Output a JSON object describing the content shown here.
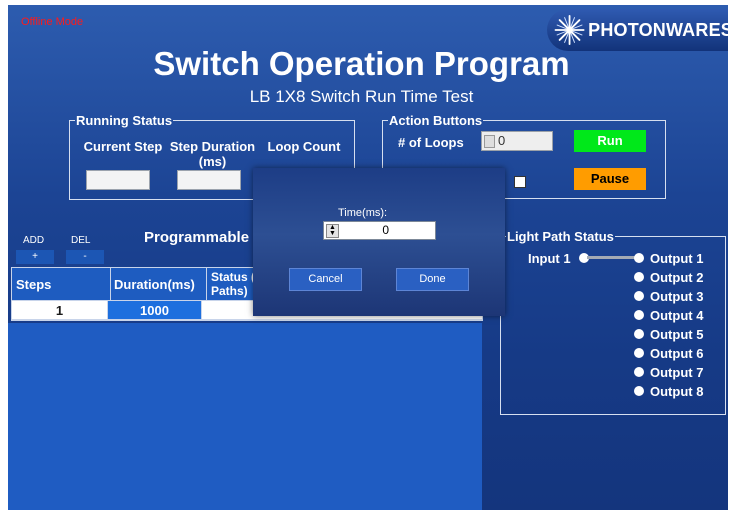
{
  "offline_mode": "Offline Mode",
  "logo": {
    "brand": "PHOTONWARES"
  },
  "title": "Switch Operation Program",
  "subtitle": "LB 1X8 Switch Run Time Test",
  "running_status": {
    "legend": "Running Status",
    "current_step_label": "Current Step",
    "step_duration_label": "Step Duration (ms)",
    "loop_count_label": "Loop Count",
    "current_step_value": "",
    "step_duration_value": ""
  },
  "action_buttons": {
    "legend": "Action Buttons",
    "loops_label": "# of Loops",
    "loops_value": "0",
    "run_label": "Run",
    "pause_label": "Pause"
  },
  "program": {
    "add_label": "ADD",
    "add_btn": "+",
    "del_label": "DEL",
    "del_btn": "-",
    "title": "Programmable",
    "columns": [
      "Steps",
      "Duration(ms)",
      "Status (\nPaths)"
    ],
    "rows": [
      {
        "step": "1",
        "duration": "1000"
      }
    ]
  },
  "light_path": {
    "legend": "Light Path Status",
    "input": "Input 1",
    "outputs": [
      "Output 1",
      "Output 2",
      "Output 3",
      "Output 4",
      "Output 5",
      "Output 6",
      "Output 7",
      "Output 8"
    ]
  },
  "time_dialog": {
    "label": "Time(ms):",
    "value": "0",
    "cancel": "Cancel",
    "done": "Done"
  },
  "colors": {
    "background": "#1c4494",
    "run": "#00e81a",
    "pause": "#ff9c00",
    "offline": "#ff1a1a"
  }
}
